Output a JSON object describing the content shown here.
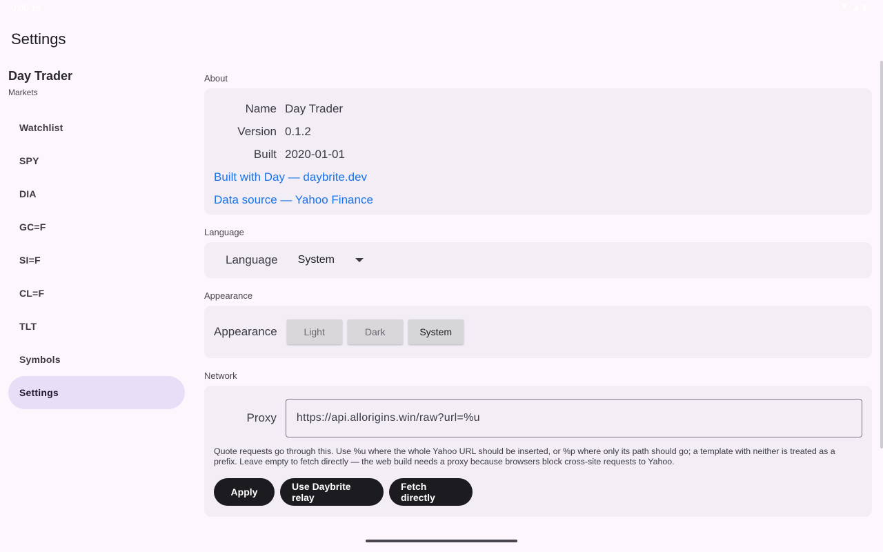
{
  "status_bar": {
    "time": "0:00 19",
    "icons": [
      "wifi-icon",
      "signal-icon",
      "battery-icon"
    ]
  },
  "page": {
    "title": "Settings"
  },
  "sidebar": {
    "app_name": "Day Trader",
    "app_subtitle": "Markets",
    "items": [
      {
        "label": "Watchlist"
      },
      {
        "label": "SPY"
      },
      {
        "label": "DIA"
      },
      {
        "label": "GC=F"
      },
      {
        "label": "SI=F"
      },
      {
        "label": "CL=F"
      },
      {
        "label": "TLT"
      },
      {
        "label": "Symbols"
      },
      {
        "label": "Settings",
        "active": true
      }
    ]
  },
  "about": {
    "section_label": "About",
    "name_key": "Name",
    "name_val": "Day Trader",
    "version_key": "Version",
    "version_val": "0.1.2",
    "built_key": "Built",
    "built_val": "2020-01-01",
    "link_built_with": "Built with Day — daybrite.dev",
    "link_data_source": "Data source — Yahoo Finance"
  },
  "language": {
    "section_label": "Language",
    "label": "Language",
    "selected": "System"
  },
  "appearance": {
    "section_label": "Appearance",
    "label": "Appearance",
    "options": [
      "Light",
      "Dark",
      "System"
    ],
    "selected": "System"
  },
  "network": {
    "section_label": "Network",
    "proxy_label": "Proxy",
    "proxy_value": "https://api.allorigins.win/raw?url=%u",
    "help_text": "Quote requests go through this. Use %u where the whole Yahoo URL should be inserted, or %p where only its path should go; a template with neither is treated as a prefix. Leave empty to fetch directly — the web build needs a proxy because browsers block cross-site requests to Yahoo.",
    "apply_label": "Apply",
    "relay_label": "Use Daybrite relay",
    "direct_label": "Fetch directly"
  },
  "colors": {
    "accent": "#e8def8",
    "link": "#1a73e8",
    "card": "#f3edf6",
    "button": "#1c1b1f"
  }
}
